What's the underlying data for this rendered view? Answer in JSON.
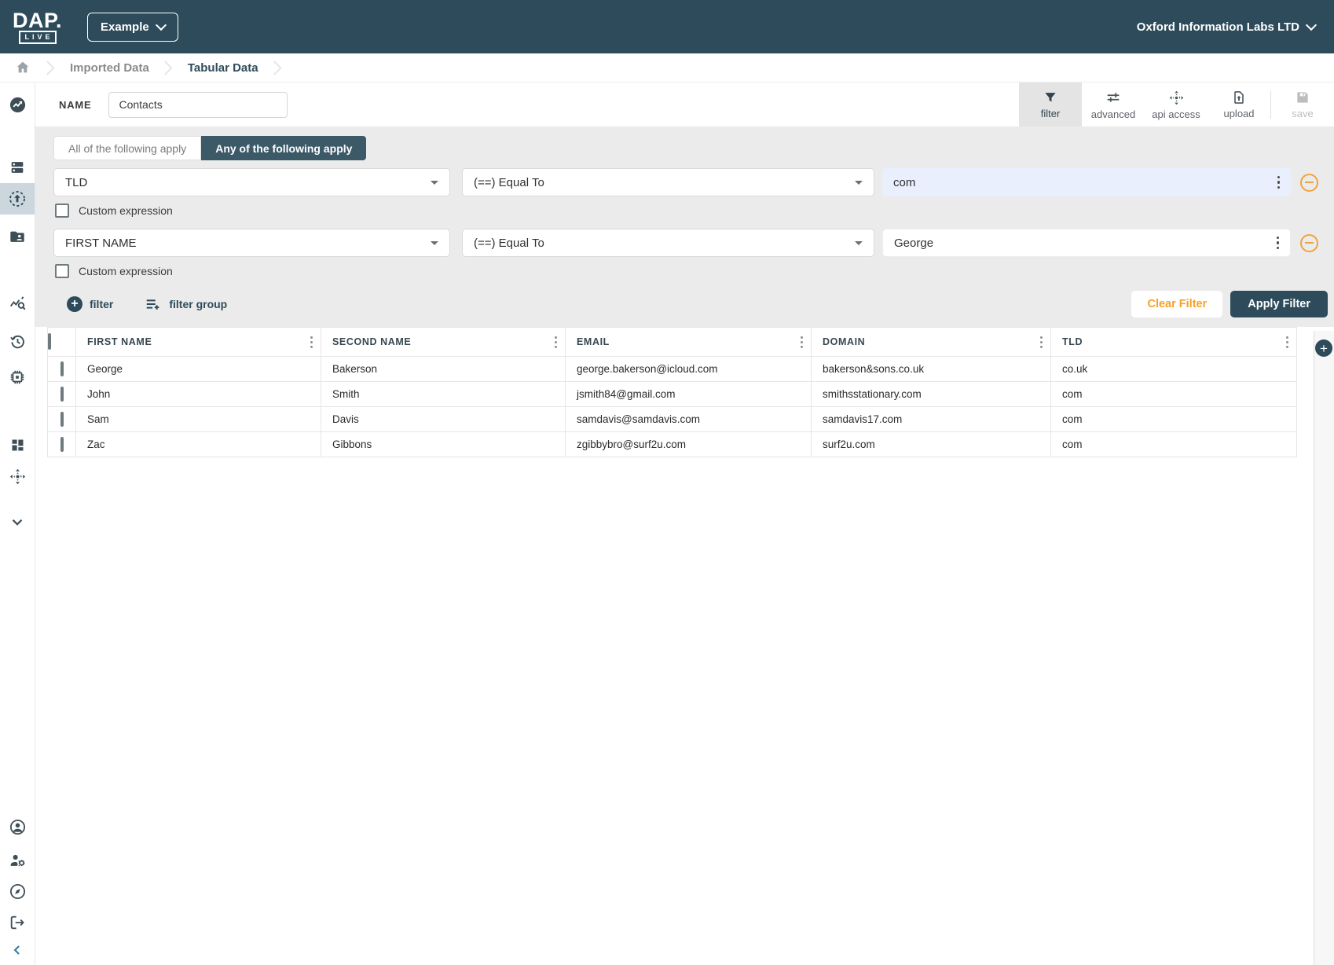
{
  "header": {
    "logo_main": "DAP.",
    "logo_sub": "LIVE",
    "project_button_label": "Example",
    "org_name": "Oxford Information Labs LTD"
  },
  "breadcrumb": {
    "items": [
      "Imported Data",
      "Tabular Data"
    ]
  },
  "toolbar": {
    "name_label": "NAME",
    "name_value": "Contacts",
    "buttons": [
      {
        "label": "filter",
        "active": true
      },
      {
        "label": "advanced"
      },
      {
        "label": "api access"
      },
      {
        "label": "upload"
      },
      {
        "label": "save",
        "disabled": true
      }
    ]
  },
  "filter_panel": {
    "all_toggle_label": "All of the following apply",
    "any_toggle_label": "Any of the following apply",
    "selected_toggle": "Any of the following apply",
    "custom_expression_label": "Custom expression",
    "rows": [
      {
        "field": "TLD",
        "operator": "(==) Equal To",
        "value": "com",
        "highlighted": true
      },
      {
        "field": "FIRST NAME",
        "operator": "(==) Equal To",
        "value": "George",
        "highlighted": false
      }
    ],
    "add_filter_label": "filter",
    "add_filter_group_label": "filter group",
    "clear_button_label": "Clear Filter",
    "apply_button_label": "Apply Filter"
  },
  "table": {
    "columns": [
      "FIRST NAME",
      "SECOND NAME",
      "EMAIL",
      "DOMAIN",
      "TLD"
    ],
    "rows": [
      [
        "George",
        "Bakerson",
        "george.bakerson@icloud.com",
        "bakerson&sons.co.uk",
        "co.uk"
      ],
      [
        "John",
        "Smith",
        "jsmith84@gmail.com",
        "smithsstationary.com",
        "com"
      ],
      [
        "Sam",
        "Davis",
        "samdavis@samdavis.com",
        "samdavis17.com",
        "com"
      ],
      [
        "Zac",
        "Gibbons",
        "zgibbybro@surf2u.com",
        "surf2u.com",
        "com"
      ]
    ]
  },
  "sidebar": {
    "items": [
      {
        "icon": "insights-icon"
      },
      {
        "icon": "dns-icon"
      },
      {
        "icon": "import-target-icon",
        "active": true
      },
      {
        "icon": "folder-shared-icon"
      },
      {
        "icon": "query-stats-icon"
      },
      {
        "icon": "history-icon"
      },
      {
        "icon": "memory-chip-icon"
      },
      {
        "icon": "dashboard-icon"
      },
      {
        "icon": "api-move-icon"
      },
      {
        "icon": "chevron-down-icon"
      }
    ],
    "bottom_items": [
      {
        "icon": "account-icon"
      },
      {
        "icon": "manage-accounts-icon"
      },
      {
        "icon": "explore-icon"
      },
      {
        "icon": "logout-icon"
      }
    ]
  },
  "colors": {
    "brand_navy": "#2d4b5a",
    "accent_orange": "#f5a126",
    "highlight_blue": "#e9effd",
    "panel_gray": "#ebebeb"
  }
}
